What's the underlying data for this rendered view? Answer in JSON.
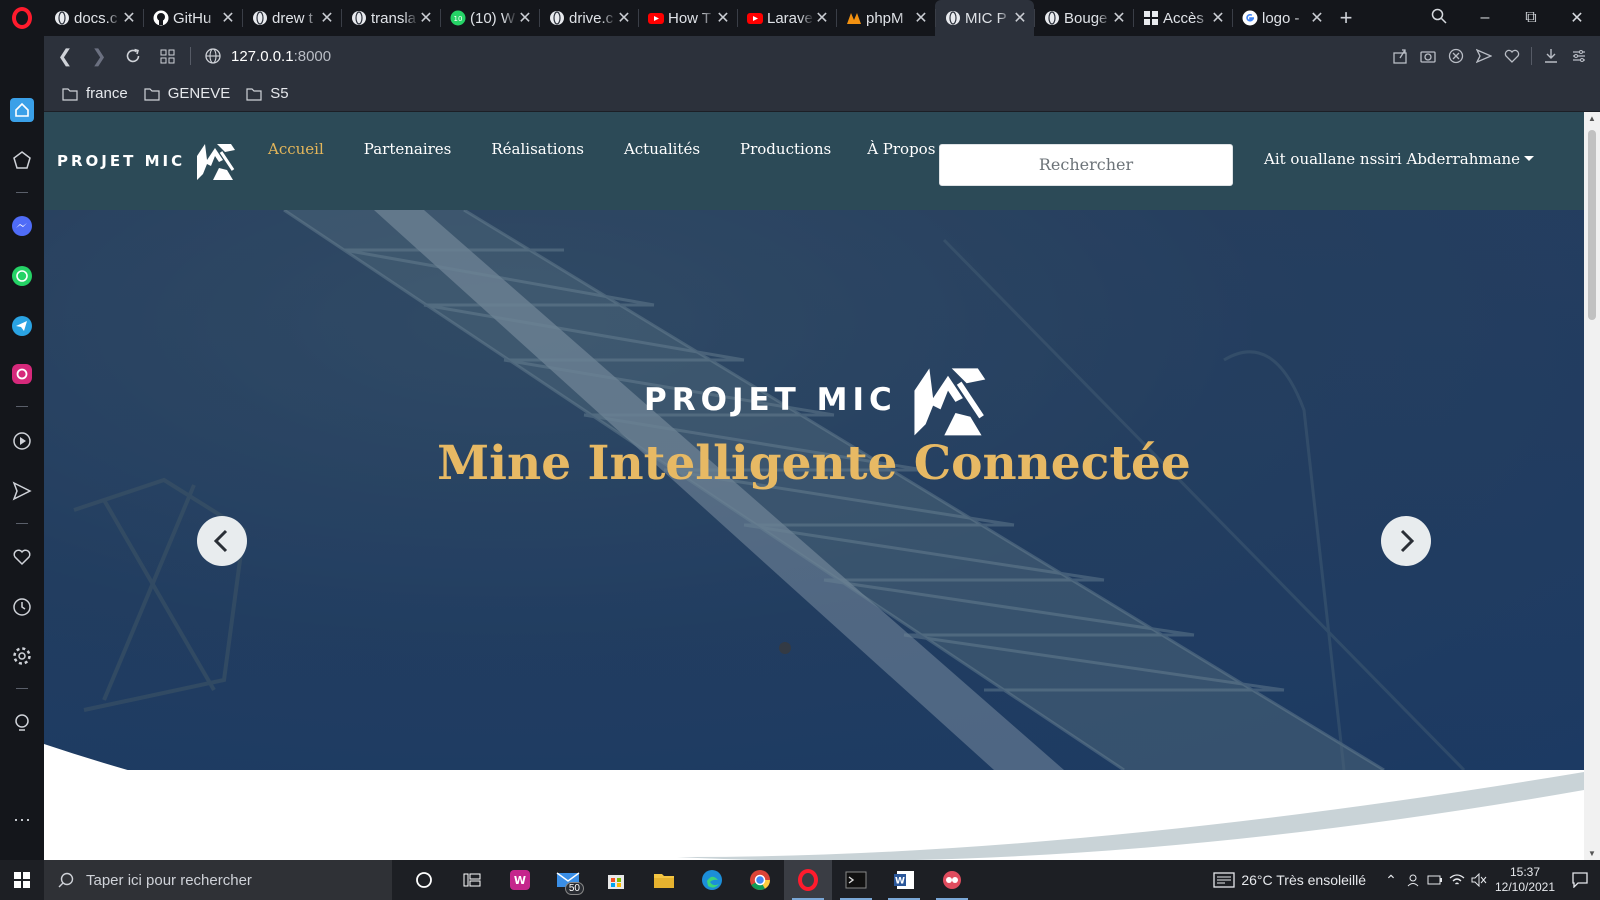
{
  "browser": {
    "tabs": [
      {
        "title": "docs.c",
        "favicon": "opera-globe-icon"
      },
      {
        "title": "GitHu",
        "favicon": "github-icon"
      },
      {
        "title": "drew t",
        "favicon": "opera-globe-icon"
      },
      {
        "title": "transla",
        "favicon": "opera-globe-icon"
      },
      {
        "title": "(10) W",
        "favicon": "whatsapp-icon"
      },
      {
        "title": "drive.c",
        "favicon": "opera-globe-icon"
      },
      {
        "title": "How T",
        "favicon": "youtube-icon"
      },
      {
        "title": "Larave",
        "favicon": "youtube-icon"
      },
      {
        "title": "phpM",
        "favicon": "phpmyadmin-icon"
      },
      {
        "title": "MIC P",
        "favicon": "opera-globe-icon",
        "active": true
      },
      {
        "title": "Bouge",
        "favicon": "opera-globe-icon"
      },
      {
        "title": "Accès",
        "favicon": "grid-icon"
      },
      {
        "title": "logo -",
        "favicon": "google-icon"
      }
    ],
    "address": {
      "host": "127.0.0.1",
      "port": ":8000"
    },
    "bookmarks": [
      "france",
      "GENEVE",
      "S5"
    ]
  },
  "site": {
    "brand": "PROJET MIC",
    "menu": [
      "Accueil",
      "Partenaires",
      "Réalisations",
      "Actualités",
      "Productions",
      "À Propos"
    ],
    "active_menu": "Accueil",
    "search_placeholder": "Rechercher",
    "user_name": "Ait ouallane nssiri Abderrahmane",
    "hero": {
      "brand": "PROJET MIC",
      "title": "Mine Intelligente Connectée",
      "slides": 1,
      "current_slide": 1
    },
    "colors": {
      "navbar": "#2c4a57",
      "accent": "#e4b65a",
      "hero_title": "#e7b964"
    }
  },
  "taskbar": {
    "search_placeholder": "Taper ici pour rechercher",
    "mail_badge": "50",
    "weather": "26°C  Très ensoleillé",
    "time": "15:37",
    "date": "12/10/2021"
  }
}
